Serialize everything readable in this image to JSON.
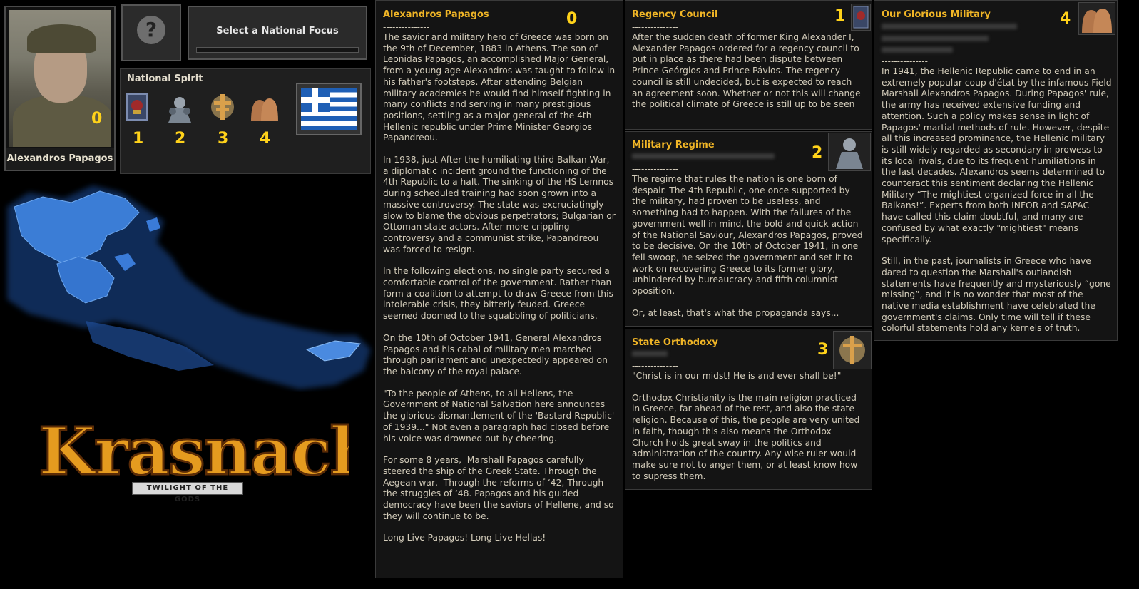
{
  "leader": {
    "name": "Alexandros Papagos",
    "number": "0"
  },
  "focus": {
    "label": "Select a National Focus",
    "icon": "question-mark-icon"
  },
  "spirits": {
    "title": "National Spirit",
    "items": [
      {
        "number": "1",
        "icon": "regency-council-icon"
      },
      {
        "number": "2",
        "icon": "military-regime-icon"
      },
      {
        "number": "3",
        "icon": "orthodox-cross-icon"
      },
      {
        "number": "4",
        "icon": "soldiers-helmets-icon"
      }
    ]
  },
  "flag": {
    "icon": "greek-flag-icon",
    "colors": {
      "blue": "#1f5fb5",
      "white": "#ffffff"
    }
  },
  "logo": {
    "title": "Krasnacht",
    "subtitle": "TWILIGHT OF THE GODS",
    "accent": "#e59b1f"
  },
  "panels": {
    "papagos": {
      "title": "Alexandros Papagos",
      "number": "0",
      "separator": "---------------",
      "paragraphs": [
        "The savior and military hero of Greece was born on the 9th of December, 1883 in Athens. The son of Leonidas Papagos, an accomplished Major General,  from a young age Alexandros was taught to follow in his father's footsteps. After attending Belgian military academies he would find himself fighting in many conflicts and serving in many prestigious positions, settling as a major general of the 4th Hellenic republic under Prime Minister Georgios Papandreou.",
        "In 1938, just After the humiliating third Balkan War, a diplomatic incident ground the functioning of the 4th Republic to a halt. The sinking of the HS Lemnos during scheduled training had soon grown into a massive controversy. The state was excruciatingly slow to blame the obvious perpetrators; Bulgarian or Ottoman state actors. After more crippling controversy and a communist strike, Papandreou was forced to resign.",
        "In the following elections, no single party secured a comfortable control of the government. Rather than form a coalition to attempt to draw Greece from this intolerable crisis, they bitterly feuded. Greece seemed doomed to the squabbling of politicians.",
        "On the 10th of October 1941, General Alexandros Papagos and his cabal of military men marched through parliament and unexpectedly appeared on the balcony of the royal palace.",
        "\"To the people of Athens, to all Hellens, the Government of National Salvation here announces the glorious dismantlement of the 'Bastard Republic' of 1939...\" Not even a paragraph had closed before his voice was drowned out by cheering.",
        "For some 8 years,  Marshall Papagos carefully steered the ship of the Greek State. Through the Aegean war,  Through the reforms of ‘42, Through the struggles of ‘48. Papagos and his guided democracy have been the saviors of Hellene, and so they will continue to be.",
        "Long Live Papagos! Long Live Hellas!"
      ]
    },
    "regency": {
      "title": "Regency Council",
      "number": "1",
      "separator": "---------------",
      "text": "After the sudden death of former King Alexander I, Alexander Papagos ordered for a regency council to put in place as there had been dispute between Prince Geórgios and Prince Pávlos. The regency council is still undecided, but is expected to reach an agreement soon. Whether or not this will change the political climate of Greece is still up to be seen"
    },
    "regime": {
      "title": "Military Regime",
      "number": "2",
      "separator": "---------------",
      "paragraphs": [
        "The regime that rules the nation is one born of despair. The 4th Republic, one once supported by the military, had proven to be useless, and something had to happen. With the failures of the government well in mind, the bold and quick action of the National Saviour, Alexandros Papagos, proved to be decisive. On the 10th of October 1941, in one fell swoop, he seized the government and set it to work on recovering Greece to its former glory, unhindered by bureaucracy and fifth columnist oposition.",
        "Or, at least, that's what the propaganda says..."
      ]
    },
    "orthodoxy": {
      "title": "State Orthodoxy",
      "number": "3",
      "separator": "---------------",
      "paragraphs": [
        "\"Christ is in our midst! He is and ever shall be!\"",
        "Orthodox Christianity is the main religion practiced in Greece, far ahead of the rest, and also the state religion. Because of this, the people are very united in faith, though this also means the Orthodox Church holds great sway in the politics and administration of the country. Any wise ruler would make sure not to anger them, or at least know how to supress them."
      ]
    },
    "military": {
      "title": "Our Glorious Military",
      "number": "4",
      "separator": "---------------",
      "paragraphs": [
        "In 1941, the Hellenic Republic came to end in an extremely popular coup d'état by the infamous Field Marshall Alexandros Papagos. During Papagos' rule, the army has received extensive funding and attention. Such a policy makes sense in light of Papagos' martial methods of rule. However, despite all this increased prominence, the Hellenic military is still widely regarded as secondary in prowess to its local rivals, due to its frequent humiliations in the last decades. Alexandros seems determined to counteract this sentiment declaring the Hellenic Military “The mightiest organized force in all the Balkans!”. Experts from both INFOR and SAPAC have called this claim doubtful, and many are confused by what exactly \"mightiest\" means specifically.",
        "Still, in the past, journalists in Greece who have dared to question the Marshall's outlandish statements have frequently and mysteriously “gone missing”, and it is no wonder that most of the native media establishment have celebrated the government's claims. Only time will tell if these colorful statements hold any kernels of truth."
      ]
    }
  }
}
